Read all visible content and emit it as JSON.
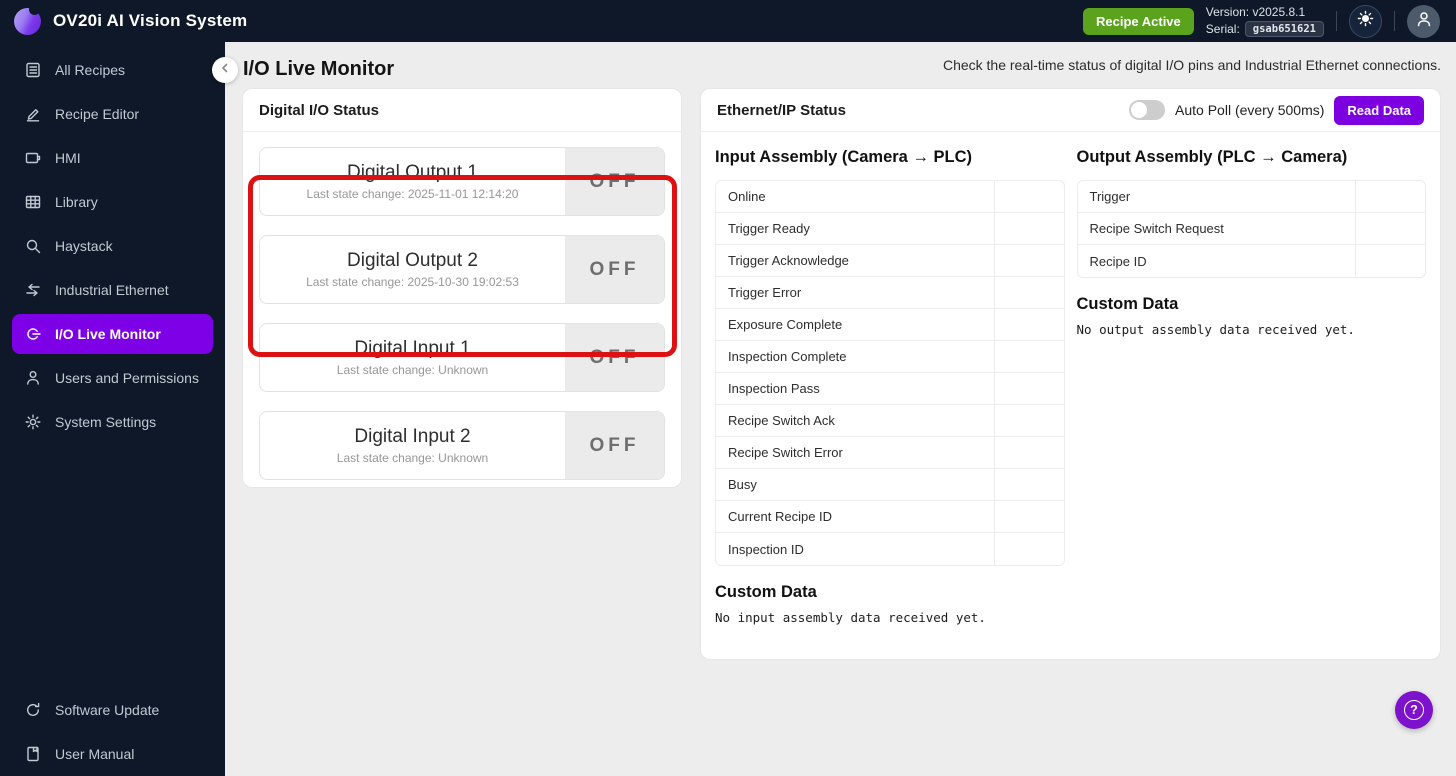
{
  "topbar": {
    "title": "OV20i AI Vision System",
    "recipe_badge": "Recipe Active",
    "version_line": "Version: v2025.8.1",
    "serial_label": "Serial:",
    "serial_value": "gsab651621"
  },
  "sidebar": {
    "items": [
      {
        "label": "All Recipes"
      },
      {
        "label": "Recipe Editor"
      },
      {
        "label": "HMI"
      },
      {
        "label": "Library"
      },
      {
        "label": "Haystack"
      },
      {
        "label": "Industrial Ethernet"
      },
      {
        "label": "I/O Live Monitor",
        "active": true
      },
      {
        "label": "Users and Permissions"
      },
      {
        "label": "System Settings"
      }
    ],
    "footer_items": [
      {
        "label": "Software Update"
      },
      {
        "label": "User Manual"
      }
    ]
  },
  "page": {
    "title": "I/O Live Monitor",
    "description": "Check the real-time status of digital I/O pins and Industrial Ethernet connections."
  },
  "digital_io": {
    "panel_title": "Digital I/O Status",
    "cards": [
      {
        "title": "Digital Output 1",
        "subtitle": "Last state change: 2025-11-01 12:14:20",
        "state": "OFF",
        "highlighted": true
      },
      {
        "title": "Digital Output 2",
        "subtitle": "Last state change: 2025-10-30 19:02:53",
        "state": "OFF",
        "highlighted": true
      },
      {
        "title": "Digital Input 1",
        "subtitle": "Last state change: Unknown",
        "state": "OFF",
        "highlighted": false
      },
      {
        "title": "Digital Input 2",
        "subtitle": "Last state change: Unknown",
        "state": "OFF",
        "highlighted": false
      }
    ]
  },
  "ethernet": {
    "panel_title": "Ethernet/IP Status",
    "auto_poll_label": "Auto Poll (every 500ms)",
    "auto_poll_state": "off",
    "read_data_label": "Read Data",
    "input_assembly": {
      "title": "Input Assembly (Camera → PLC)",
      "rows": [
        "Online",
        "Trigger Ready",
        "Trigger Acknowledge",
        "Trigger Error",
        "Exposure Complete",
        "Inspection Complete",
        "Inspection Pass",
        "Recipe Switch Ack",
        "Recipe Switch Error",
        "Busy",
        "Current Recipe ID",
        "Inspection ID"
      ],
      "custom_data_title": "Custom Data",
      "custom_data_message": "No input assembly data received yet."
    },
    "output_assembly": {
      "title": "Output Assembly (PLC → Camera)",
      "rows": [
        "Trigger",
        "Recipe Switch Request",
        "Recipe ID"
      ],
      "custom_data_title": "Custom Data",
      "custom_data_message": "No output assembly data received yet."
    }
  },
  "help": {
    "glyph": "?"
  },
  "colors": {
    "topbar_bg": "#0e1828",
    "sidebar_bg": "#0e1828",
    "accent_purple": "#7d00e6",
    "read_data_purple": "#7c00e0",
    "recipe_badge_green": "#5ba31c",
    "annotation_red": "#dd1111",
    "main_bg": "#ededed",
    "off_state_gray": "#ebebeb"
  }
}
